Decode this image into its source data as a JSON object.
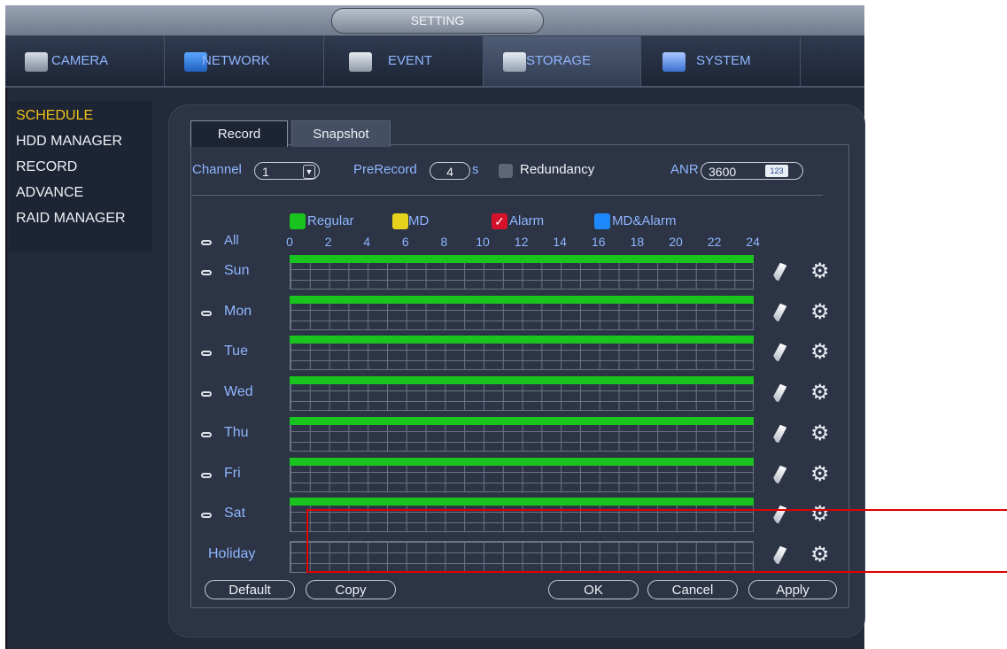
{
  "title": "SETTING",
  "tabs": [
    {
      "label": "CAMERA",
      "icon": "camera-icon",
      "active": false
    },
    {
      "label": "NETWORK",
      "icon": "network-icon",
      "active": false
    },
    {
      "label": "EVENT",
      "icon": "event-icon",
      "active": false
    },
    {
      "label": "STORAGE",
      "icon": "storage-icon",
      "active": true
    },
    {
      "label": "SYSTEM",
      "icon": "system-icon",
      "active": false
    }
  ],
  "sidebar": {
    "items": [
      {
        "label": "SCHEDULE",
        "active": true
      },
      {
        "label": "HDD MANAGER",
        "active": false
      },
      {
        "label": "RECORD",
        "active": false
      },
      {
        "label": "ADVANCE",
        "active": false
      },
      {
        "label": "RAID MANAGER",
        "active": false
      }
    ]
  },
  "subtabs": {
    "record": "Record",
    "snapshot": "Snapshot"
  },
  "controls": {
    "channel_label": "Channel",
    "channel_value": "1",
    "prerecord_label": "PreRecord",
    "prerecord_value": "4",
    "prerecord_unit": "s",
    "redundancy_label": "Redundancy",
    "anr_label": "ANR",
    "anr_value": "3600",
    "anr_kbd": "123"
  },
  "legend": {
    "regular": "Regular",
    "md": "MD",
    "alarm": "Alarm",
    "md_alarm": "MD&Alarm",
    "colors": {
      "regular": "#19c41f",
      "md": "#e6d21c",
      "alarm": "#d6122a",
      "md_alarm": "#1e88ff"
    }
  },
  "schedule": {
    "all_label": "All",
    "hours": [
      "0",
      "2",
      "4",
      "6",
      "8",
      "10",
      "12",
      "14",
      "16",
      "18",
      "20",
      "22",
      "24"
    ],
    "days": [
      "Sun",
      "Mon",
      "Tue",
      "Wed",
      "Thu",
      "Fri",
      "Sat"
    ],
    "holiday": "Holiday"
  },
  "buttons": {
    "default": "Default",
    "copy": "Copy",
    "ok": "OK",
    "cancel": "Cancel",
    "apply": "Apply"
  }
}
